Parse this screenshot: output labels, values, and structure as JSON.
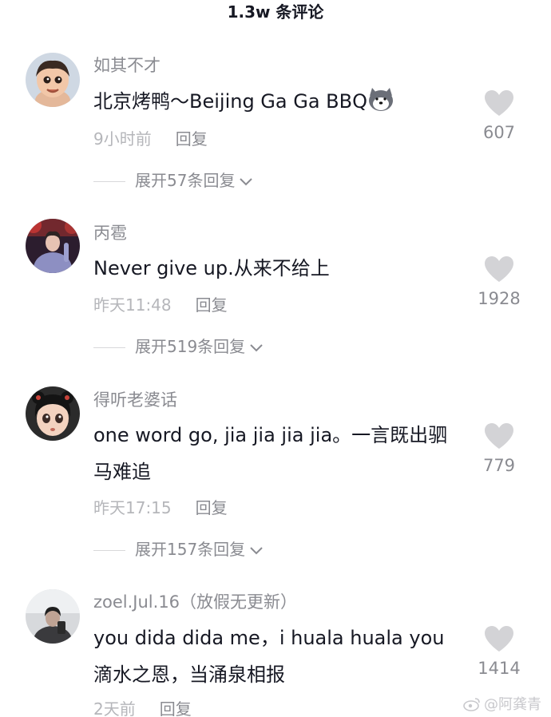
{
  "header": {
    "title": "1.3w 条评论"
  },
  "comments": [
    {
      "username": "如其不才",
      "text_line1": "北京烤鸭～Beijing Ga Ga BBQ",
      "time": "9小时前",
      "reply_label": "回复",
      "likes": "607",
      "expand_label": "展开57条回复",
      "emoji": "husky-dog-emoji"
    },
    {
      "username": "丙雹",
      "text_line1": "Never give up.从来不给上",
      "time": "昨天11:48",
      "reply_label": "回复",
      "likes": "1928",
      "expand_label": "展开519条回复"
    },
    {
      "username": "得听老婆话",
      "text_line1": "one word go, jia jia jia jia。一言既出驷",
      "text_line2": "马难追",
      "time": "昨天17:15",
      "reply_label": "回复",
      "likes": "779",
      "expand_label": "展开157条回复"
    },
    {
      "username": "zoel.Jul.16（放假无更新）",
      "text_line1": "you dida dida me，i huala huala you",
      "text_line2": "滴水之恩，当涌泉相报",
      "time": "2天前",
      "reply_label": "回复",
      "likes": "1414"
    }
  ],
  "watermark": {
    "text": "@阿龚青",
    "icon": "weibo-icon"
  },
  "colors": {
    "primary_text": "#161823",
    "secondary_text": "#8a8b91",
    "time_text": "#b5b6ba",
    "heart": "#d3d3d6"
  }
}
